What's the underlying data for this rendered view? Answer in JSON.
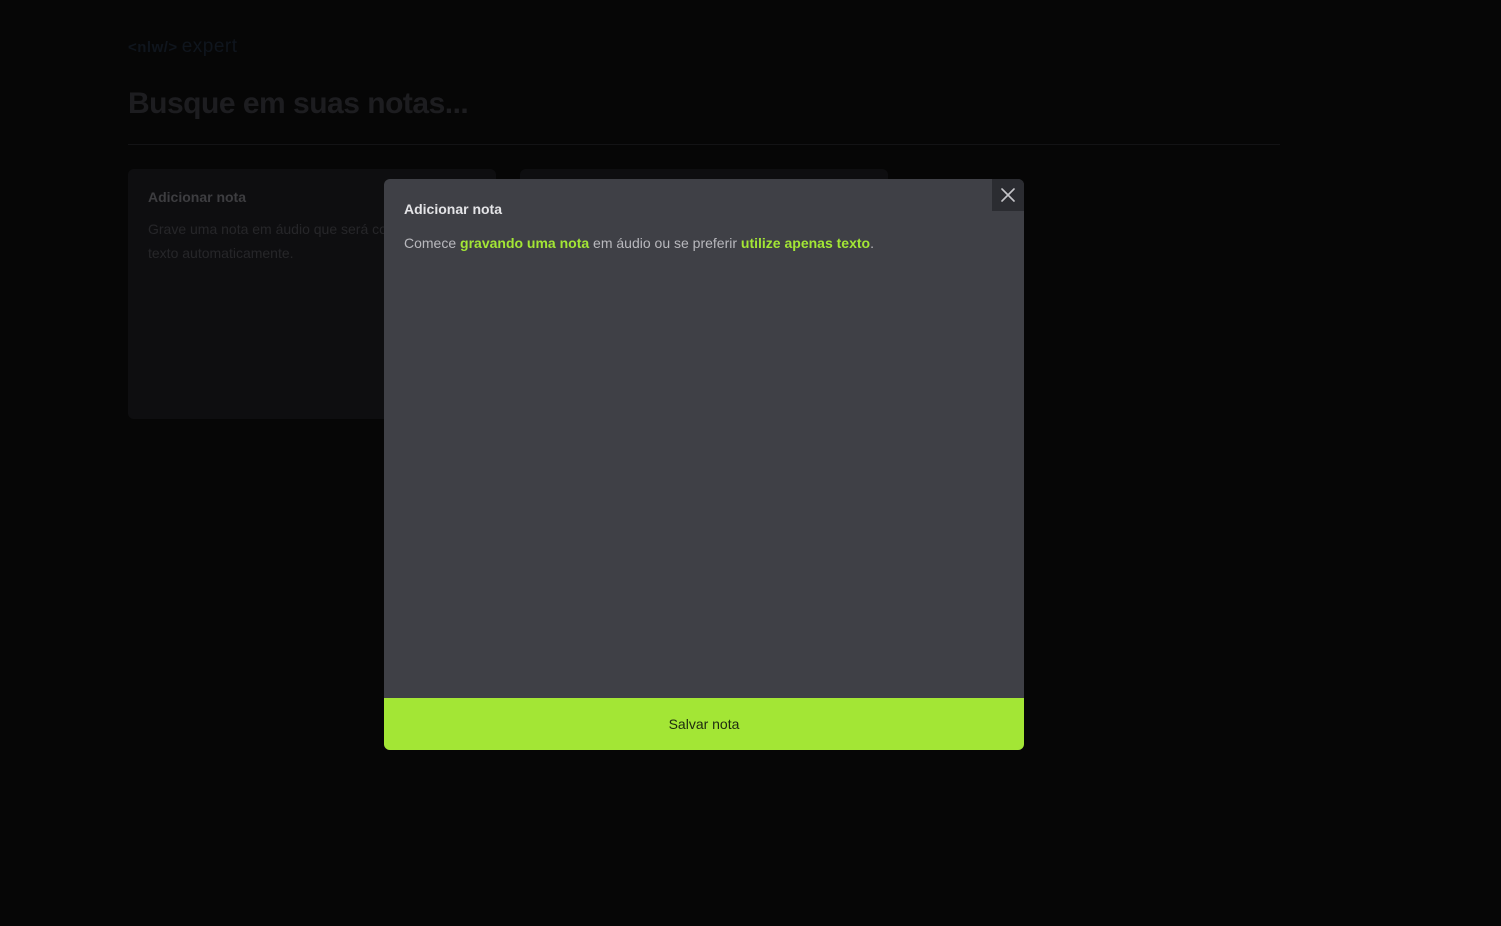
{
  "logo": {
    "tag": "<nlw/>",
    "suffix": "expert"
  },
  "search": {
    "placeholder": "Busque em suas notas..."
  },
  "cards": {
    "add_note": {
      "title": "Adicionar nota",
      "text": "Grave uma nota em áudio que será convertida para texto automaticamente."
    }
  },
  "modal": {
    "title": "Adicionar nota",
    "text_prefix": "Comece ",
    "link_record": "gravando uma nota",
    "text_middle": " em áudio ou se preferir ",
    "link_text": "utilize apenas texto",
    "text_suffix": ".",
    "close_icon": "x-icon",
    "save_label": "Salvar nota"
  },
  "colors": {
    "background": "#0d0d0d",
    "modal": "#3f4046",
    "accent": "#a3e635"
  }
}
